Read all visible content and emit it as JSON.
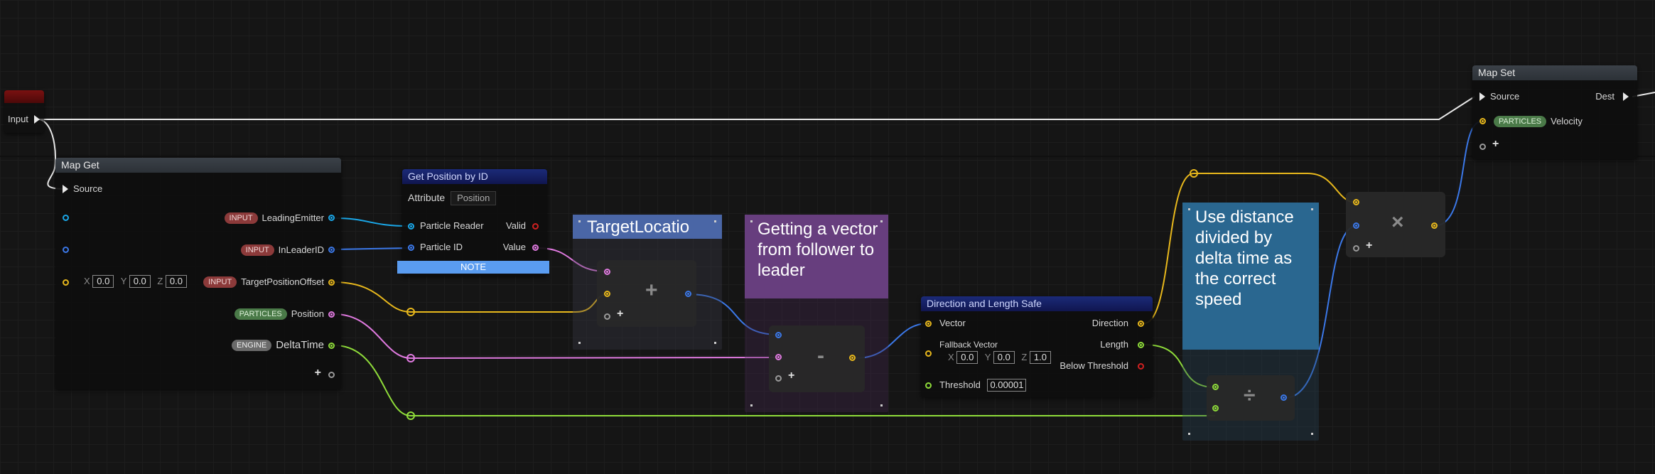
{
  "input_node": {
    "label": "Input"
  },
  "map_get": {
    "title": "Map Get",
    "source": "Source",
    "outputs": [
      {
        "tag": "INPUT",
        "name": "LeadingEmitter"
      },
      {
        "tag": "INPUT",
        "name": "InLeaderID"
      },
      {
        "tag": "INPUT",
        "name": "TargetPositionOffset"
      },
      {
        "tag": "PARTICLES",
        "name": "Position"
      },
      {
        "tag": "ENGINE",
        "name": "DeltaTime"
      }
    ],
    "vector": {
      "x_label": "X",
      "x": "0.0",
      "y_label": "Y",
      "y": "0.0",
      "z_label": "Z",
      "z": "0.0"
    },
    "add_pin": "+"
  },
  "get_position": {
    "title": "Get Position by ID",
    "attribute_label": "Attribute",
    "attribute_value": "Position",
    "particle_reader": "Particle Reader",
    "particle_id": "Particle ID",
    "valid": "Valid",
    "value": "Value",
    "note": "NOTE"
  },
  "comments": {
    "target": "TargetLocatio",
    "vector": "Getting a vector from follower to leader",
    "speed": "Use distance divided by delta time as the correct speed"
  },
  "ops": {
    "add": "+",
    "subtract": "-",
    "divide": "÷",
    "multiply": "×",
    "add_pin": "+"
  },
  "direction_node": {
    "title": "Direction and Length Safe",
    "vector": "Vector",
    "fallback": "Fallback Vector",
    "fallback_values": {
      "x_label": "X",
      "x": "0.0",
      "y_label": "Y",
      "y": "0.0",
      "z_label": "Z",
      "z": "1.0"
    },
    "threshold_label": "Threshold",
    "threshold_value": "0.00001",
    "direction": "Direction",
    "length": "Length",
    "below_threshold": "Below Threshold"
  },
  "map_set": {
    "title": "Map Set",
    "source": "Source",
    "dest": "Dest",
    "tag": "PARTICLES",
    "name": "Velocity",
    "add_pin": "+"
  },
  "colors": {
    "exec": "#e8e8e8",
    "vector": "#e8b81c",
    "position": "#e07ae0",
    "float": "#8fdc3a",
    "struct": "#1aa7e8",
    "int": "#3b78e8"
  }
}
